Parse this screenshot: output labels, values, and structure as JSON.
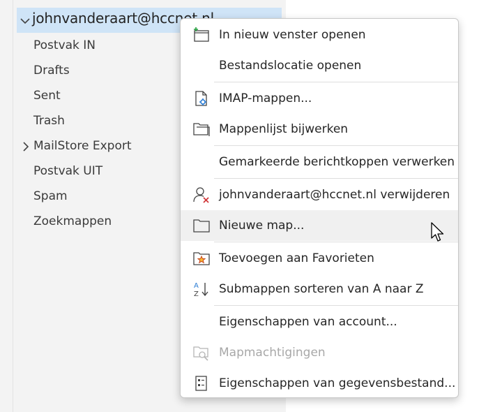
{
  "account": {
    "email": "johnvanderaart@hccnet.nl"
  },
  "folders": [
    {
      "label": "Postvak IN"
    },
    {
      "label": "Drafts"
    },
    {
      "label": "Sent"
    },
    {
      "label": "Trash"
    },
    {
      "label": "MailStore Export",
      "expandable": true
    },
    {
      "label": "Postvak UIT"
    },
    {
      "label": "Spam"
    },
    {
      "label": "Zoekmappen"
    }
  ],
  "menu": {
    "items": [
      {
        "label": "In nieuw venster openen",
        "icon": "new-window-icon"
      },
      {
        "label": "Bestandslocatie openen"
      },
      {
        "label": "IMAP-mappen...",
        "icon": "imap-folders-icon"
      },
      {
        "label": "Mappenlijst bijwerken",
        "icon": "folder-list-icon"
      },
      {
        "label": "Gemarkeerde berichtkoppen verwerken"
      },
      {
        "label": "johnvanderaart@hccnet.nl verwijderen",
        "icon": "remove-account-icon"
      },
      {
        "label": "Nieuwe map...",
        "icon": "new-folder-icon",
        "hovered": true
      },
      {
        "label": "Toevoegen aan Favorieten",
        "icon": "favorite-folder-icon"
      },
      {
        "label": "Submappen sorteren van A naar Z",
        "icon": "sort-az-icon"
      },
      {
        "label": "Eigenschappen van account..."
      },
      {
        "label": "Mapmachtigingen",
        "icon": "folder-permissions-icon",
        "disabled": true
      },
      {
        "label": "Eigenschappen van gegevensbestand...",
        "icon": "data-file-properties-icon"
      }
    ]
  },
  "colors": {
    "selection": "#cfe4f7",
    "hover": "#f0f0f0",
    "accent": "#2b7cd3"
  }
}
